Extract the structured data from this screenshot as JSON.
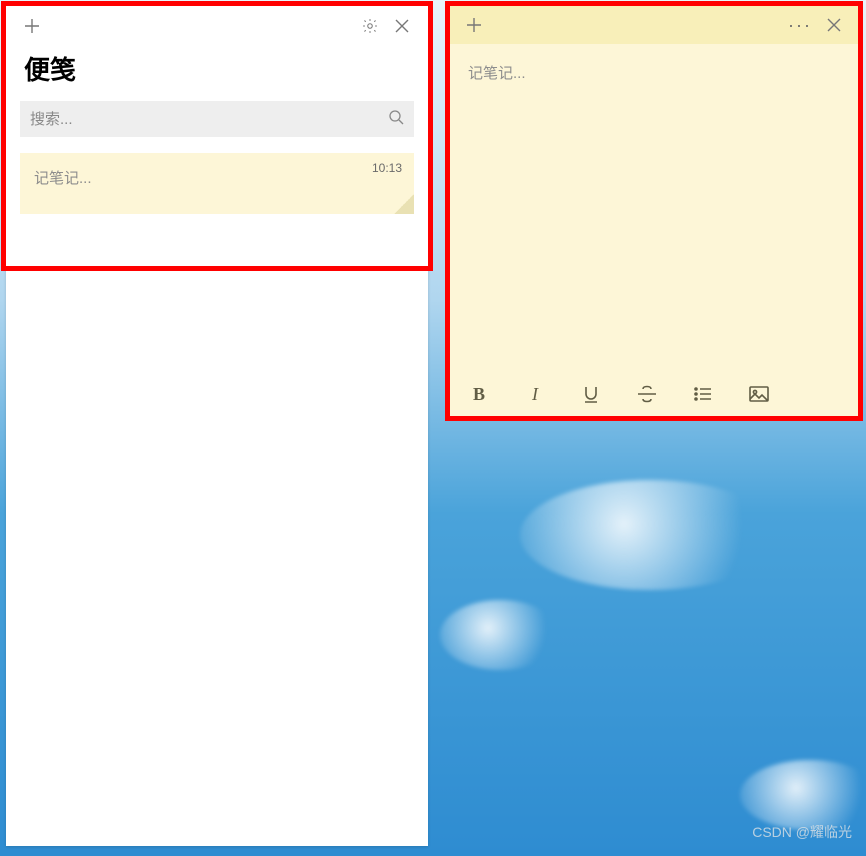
{
  "listWindow": {
    "title": "便笺",
    "search_placeholder": "搜索...",
    "items": [
      {
        "time": "10:13",
        "preview": "记笔记..."
      }
    ]
  },
  "noteWindow": {
    "placeholder": "记笔记...",
    "menu_label": "···",
    "format": {
      "bold": "B",
      "italic": "I"
    }
  },
  "watermark": "CSDN @耀临光"
}
